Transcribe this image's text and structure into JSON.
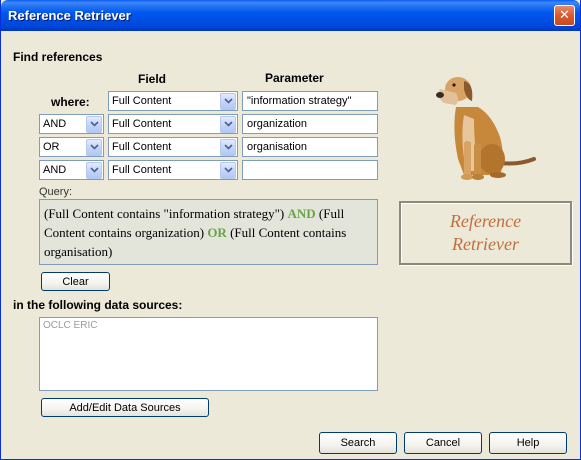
{
  "window": {
    "title": "Reference Retriever",
    "close_glyph": "✕"
  },
  "find": {
    "heading": "Find references",
    "field_header": "Field",
    "parameter_header": "Parameter",
    "where_label": "where:",
    "rows": [
      {
        "operator": "",
        "field": "Full Content",
        "parameter": "\"information strategy\""
      },
      {
        "operator": "AND",
        "field": "Full Content",
        "parameter": "organization"
      },
      {
        "operator": "OR",
        "field": "Full Content",
        "parameter": "organisation"
      },
      {
        "operator": "AND",
        "field": "Full Content",
        "parameter": ""
      }
    ]
  },
  "query": {
    "label": "Query:",
    "parts": {
      "p1": "(Full Content contains \"information strategy\") ",
      "k1": "AND",
      "p2": " (Full Content contains organization) ",
      "k2": "OR",
      "p3": " (Full Content contains organisation)"
    }
  },
  "buttons": {
    "clear": "Clear",
    "add_edit_sources": "Add/Edit Data Sources",
    "search": "Search",
    "cancel": "Cancel",
    "help": "Help"
  },
  "sources": {
    "heading": "in the following data sources:",
    "items": [
      "OCLC ERIC"
    ]
  },
  "logo": {
    "line1": "Reference",
    "line2": "Retriever"
  },
  "colors": {
    "title_bar": "#0058ee",
    "keyword": "#6aa34a",
    "logo_text": "#c07040",
    "close": "#d85a2e"
  },
  "icons": {
    "dropdown": "chevron-down-icon",
    "close": "close-icon",
    "dog": "dog-image"
  }
}
